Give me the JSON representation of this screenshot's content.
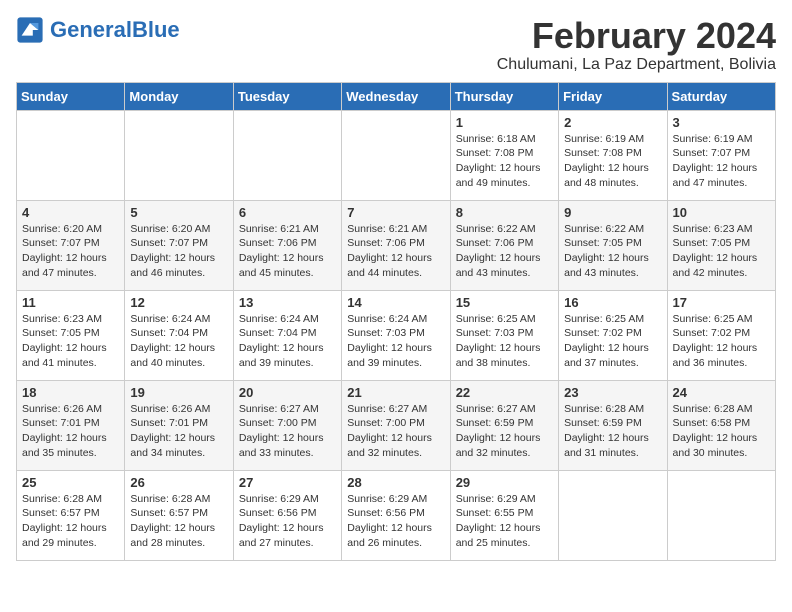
{
  "header": {
    "logo_general": "General",
    "logo_blue": "Blue",
    "month": "February 2024",
    "location": "Chulumani, La Paz Department, Bolivia"
  },
  "weekdays": [
    "Sunday",
    "Monday",
    "Tuesday",
    "Wednesday",
    "Thursday",
    "Friday",
    "Saturday"
  ],
  "weeks": [
    [
      {
        "day": "",
        "text": ""
      },
      {
        "day": "",
        "text": ""
      },
      {
        "day": "",
        "text": ""
      },
      {
        "day": "",
        "text": ""
      },
      {
        "day": "1",
        "text": "Sunrise: 6:18 AM\nSunset: 7:08 PM\nDaylight: 12 hours and 49 minutes."
      },
      {
        "day": "2",
        "text": "Sunrise: 6:19 AM\nSunset: 7:08 PM\nDaylight: 12 hours and 48 minutes."
      },
      {
        "day": "3",
        "text": "Sunrise: 6:19 AM\nSunset: 7:07 PM\nDaylight: 12 hours and 47 minutes."
      }
    ],
    [
      {
        "day": "4",
        "text": "Sunrise: 6:20 AM\nSunset: 7:07 PM\nDaylight: 12 hours and 47 minutes."
      },
      {
        "day": "5",
        "text": "Sunrise: 6:20 AM\nSunset: 7:07 PM\nDaylight: 12 hours and 46 minutes."
      },
      {
        "day": "6",
        "text": "Sunrise: 6:21 AM\nSunset: 7:06 PM\nDaylight: 12 hours and 45 minutes."
      },
      {
        "day": "7",
        "text": "Sunrise: 6:21 AM\nSunset: 7:06 PM\nDaylight: 12 hours and 44 minutes."
      },
      {
        "day": "8",
        "text": "Sunrise: 6:22 AM\nSunset: 7:06 PM\nDaylight: 12 hours and 43 minutes."
      },
      {
        "day": "9",
        "text": "Sunrise: 6:22 AM\nSunset: 7:05 PM\nDaylight: 12 hours and 43 minutes."
      },
      {
        "day": "10",
        "text": "Sunrise: 6:23 AM\nSunset: 7:05 PM\nDaylight: 12 hours and 42 minutes."
      }
    ],
    [
      {
        "day": "11",
        "text": "Sunrise: 6:23 AM\nSunset: 7:05 PM\nDaylight: 12 hours and 41 minutes."
      },
      {
        "day": "12",
        "text": "Sunrise: 6:24 AM\nSunset: 7:04 PM\nDaylight: 12 hours and 40 minutes."
      },
      {
        "day": "13",
        "text": "Sunrise: 6:24 AM\nSunset: 7:04 PM\nDaylight: 12 hours and 39 minutes."
      },
      {
        "day": "14",
        "text": "Sunrise: 6:24 AM\nSunset: 7:03 PM\nDaylight: 12 hours and 39 minutes."
      },
      {
        "day": "15",
        "text": "Sunrise: 6:25 AM\nSunset: 7:03 PM\nDaylight: 12 hours and 38 minutes."
      },
      {
        "day": "16",
        "text": "Sunrise: 6:25 AM\nSunset: 7:02 PM\nDaylight: 12 hours and 37 minutes."
      },
      {
        "day": "17",
        "text": "Sunrise: 6:25 AM\nSunset: 7:02 PM\nDaylight: 12 hours and 36 minutes."
      }
    ],
    [
      {
        "day": "18",
        "text": "Sunrise: 6:26 AM\nSunset: 7:01 PM\nDaylight: 12 hours and 35 minutes."
      },
      {
        "day": "19",
        "text": "Sunrise: 6:26 AM\nSunset: 7:01 PM\nDaylight: 12 hours and 34 minutes."
      },
      {
        "day": "20",
        "text": "Sunrise: 6:27 AM\nSunset: 7:00 PM\nDaylight: 12 hours and 33 minutes."
      },
      {
        "day": "21",
        "text": "Sunrise: 6:27 AM\nSunset: 7:00 PM\nDaylight: 12 hours and 32 minutes."
      },
      {
        "day": "22",
        "text": "Sunrise: 6:27 AM\nSunset: 6:59 PM\nDaylight: 12 hours and 32 minutes."
      },
      {
        "day": "23",
        "text": "Sunrise: 6:28 AM\nSunset: 6:59 PM\nDaylight: 12 hours and 31 minutes."
      },
      {
        "day": "24",
        "text": "Sunrise: 6:28 AM\nSunset: 6:58 PM\nDaylight: 12 hours and 30 minutes."
      }
    ],
    [
      {
        "day": "25",
        "text": "Sunrise: 6:28 AM\nSunset: 6:57 PM\nDaylight: 12 hours and 29 minutes."
      },
      {
        "day": "26",
        "text": "Sunrise: 6:28 AM\nSunset: 6:57 PM\nDaylight: 12 hours and 28 minutes."
      },
      {
        "day": "27",
        "text": "Sunrise: 6:29 AM\nSunset: 6:56 PM\nDaylight: 12 hours and 27 minutes."
      },
      {
        "day": "28",
        "text": "Sunrise: 6:29 AM\nSunset: 6:56 PM\nDaylight: 12 hours and 26 minutes."
      },
      {
        "day": "29",
        "text": "Sunrise: 6:29 AM\nSunset: 6:55 PM\nDaylight: 12 hours and 25 minutes."
      },
      {
        "day": "",
        "text": ""
      },
      {
        "day": "",
        "text": ""
      }
    ]
  ]
}
